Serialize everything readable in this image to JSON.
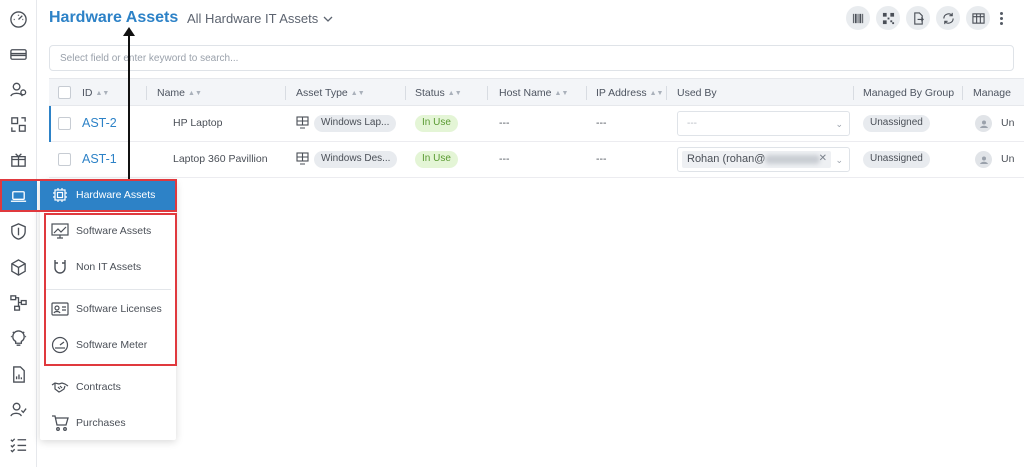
{
  "header": {
    "title": "Hardware Assets",
    "view_label": "All Hardware IT Assets",
    "actions": [
      "barcode-icon",
      "qr-icon",
      "export-icon",
      "refresh-icon",
      "table-columns-icon",
      "more-icon"
    ]
  },
  "search": {
    "placeholder": "Select field or enter keyword to search..."
  },
  "table": {
    "columns": [
      "ID",
      "Name",
      "Asset Type",
      "Status",
      "Host Name",
      "IP Address",
      "Used By",
      "Managed By Group",
      "Manage"
    ],
    "rows": [
      {
        "id": "AST-2",
        "name": "HP Laptop",
        "asset_type": "Windows Lap...",
        "status": "In Use",
        "host_name": "---",
        "ip_address": "---",
        "used_by": "---",
        "managed_by_group": "Unassigned",
        "managed_by": "Un"
      },
      {
        "id": "AST-1",
        "name": "Laptop 360 Pavillion",
        "asset_type": "Windows Des...",
        "status": "In Use",
        "host_name": "---",
        "ip_address": "---",
        "used_by": "Rohan (rohan@",
        "managed_by_group": "Unassigned",
        "managed_by": "Un"
      }
    ]
  },
  "sidebar": {
    "icons": [
      "dashboard-icon",
      "ticket-icon",
      "users-icon",
      "changes-icon",
      "release-icon",
      "asset-laptop-icon",
      "shield-icon",
      "cube-icon",
      "workflow-icon",
      "idea-icon",
      "report-icon",
      "user-check-icon",
      "checklist-icon"
    ]
  },
  "menu": {
    "active": "Hardware Assets",
    "items": [
      "Software Assets",
      "Non IT Assets",
      "Software Licenses",
      "Software Meter",
      "Contracts",
      "Purchases"
    ]
  },
  "colors": {
    "accent": "#2d82c7",
    "annotation": "#e0393e",
    "status_green": "#5a9a32"
  }
}
